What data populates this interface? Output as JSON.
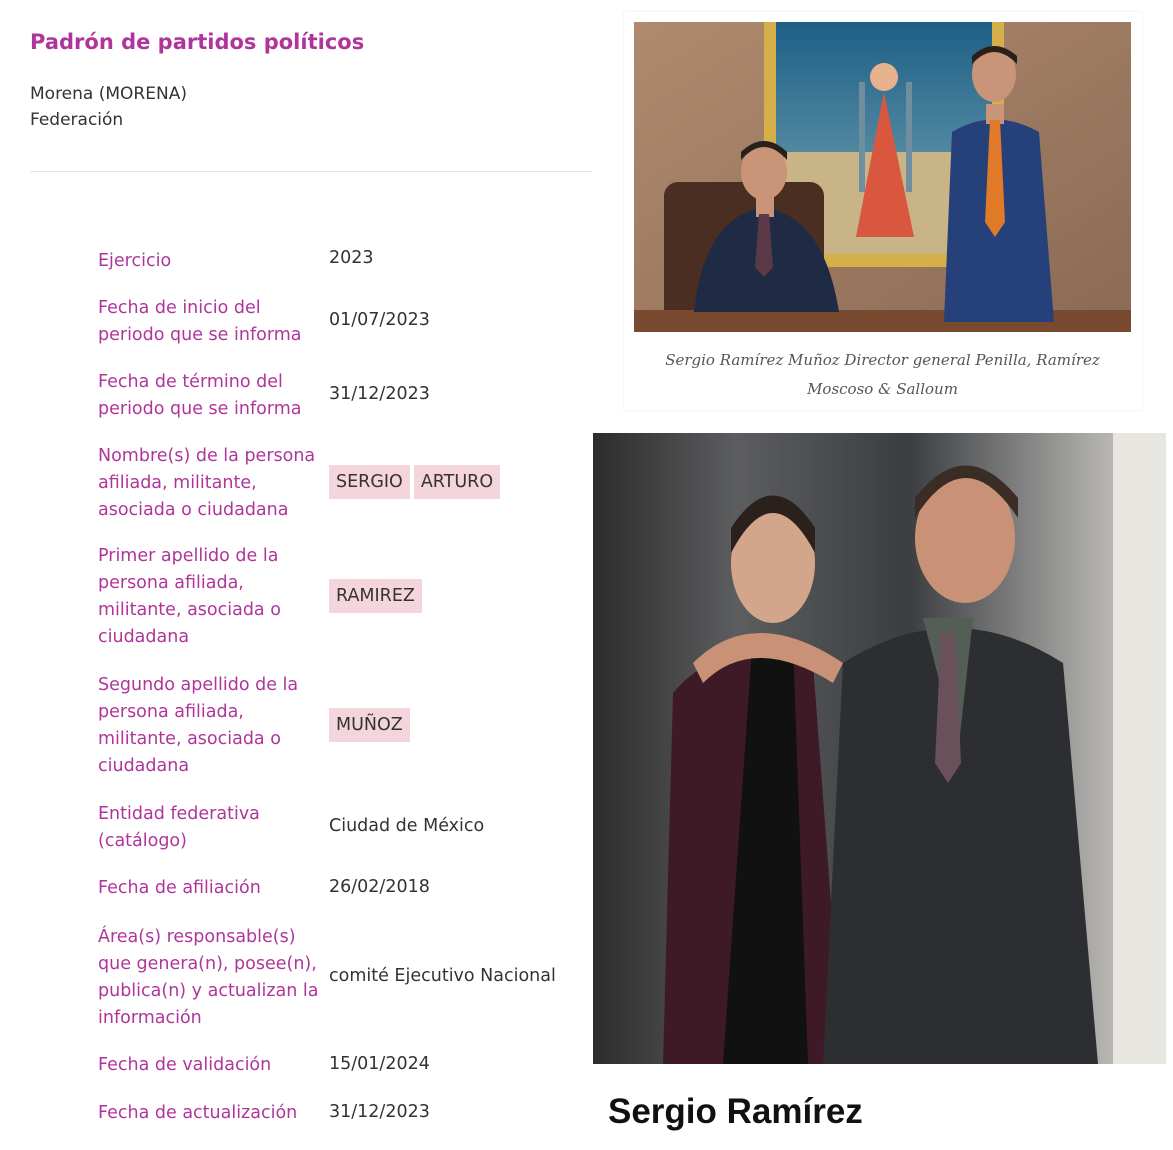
{
  "header": {
    "title": "Padrón de partidos políticos",
    "party": "Morena (MORENA)",
    "scope": "Federación"
  },
  "fields": {
    "ejercicio": {
      "label": "Ejercicio",
      "value": "2023"
    },
    "fecha_inicio": {
      "label": "Fecha de inicio del periodo que se informa",
      "value": "01/07/2023"
    },
    "fecha_termino": {
      "label": "Fecha de término del periodo que se informa",
      "value": "31/12/2023"
    },
    "nombres": {
      "label": "Nombre(s) de la persona afiliada, militante, asociada o ciudadana",
      "values": [
        "SERGIO",
        "ARTURO"
      ]
    },
    "primer_apellido": {
      "label": "Primer apellido de la persona afiliada, militante, asociada o ciudadana",
      "value": "RAMIREZ"
    },
    "segundo_apellido": {
      "label": "Segundo apellido de la persona afiliada, militante, asociada o ciudadana",
      "value": "MUÑOZ"
    },
    "entidad": {
      "label": "Entidad federativa (catálogo)",
      "value": "Ciudad de México"
    },
    "fecha_afiliacion": {
      "label": "Fecha de afiliación",
      "value": "26/02/2018"
    },
    "area": {
      "label": "Área(s) responsable(s) que genera(n), posee(n), publica(n) y actualizan la información",
      "value": "comité Ejecutivo Nacional"
    },
    "fecha_validacion": {
      "label": "Fecha de validación",
      "value": "15/01/2024"
    },
    "fecha_actualizacion": {
      "label": "Fecha de actualización",
      "value": "31/12/2023"
    }
  },
  "photo_card": {
    "caption": "Sergio Ramírez Muñoz Director general Penilla, Ramírez Moscoso & Salloum"
  },
  "name_label": "Sergio Ramírez",
  "colors": {
    "label_accent": "#b0359b",
    "chip_bg": "#f5d5dc"
  }
}
